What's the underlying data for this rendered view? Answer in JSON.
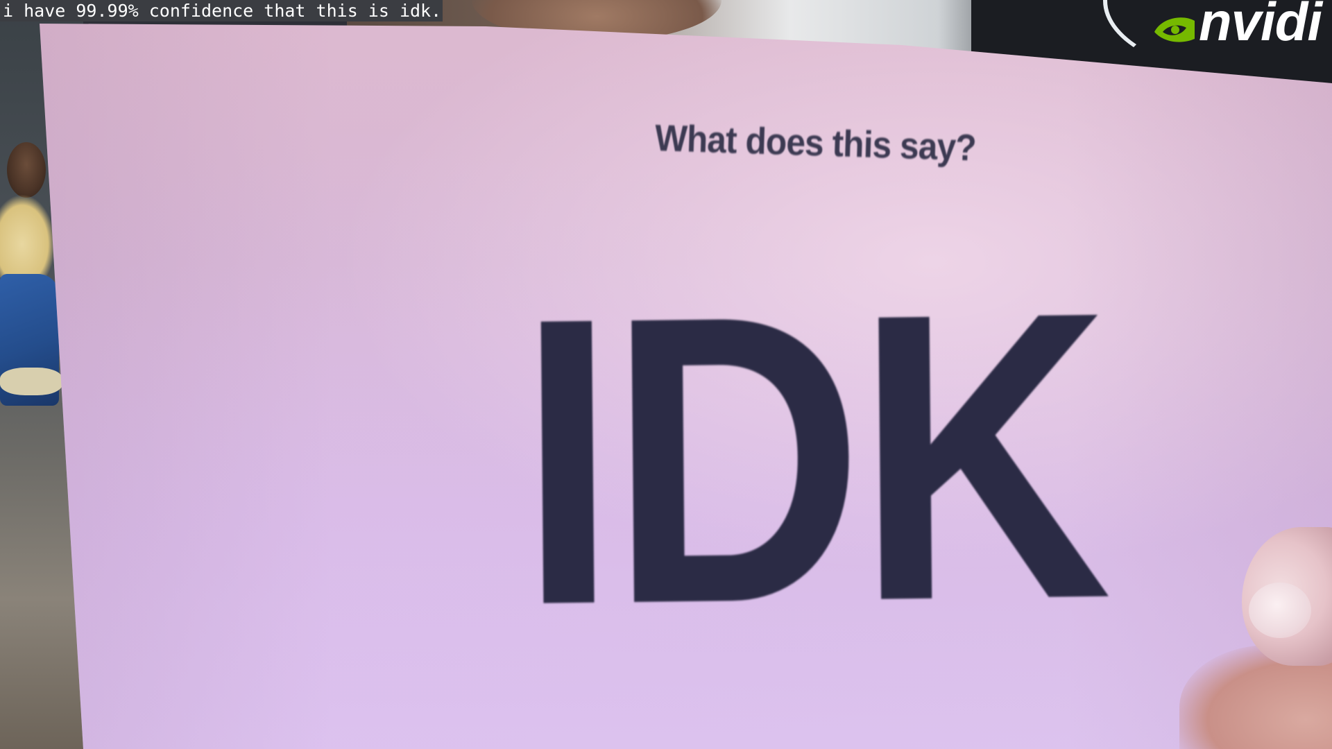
{
  "caption": {
    "text": "i have 99.99% confidence that this is idk."
  },
  "sign": {
    "question": "What does this say?",
    "word": "IDK"
  },
  "background": {
    "logo_icon": "nvidia-eye-icon",
    "logo_text": "nvidi"
  },
  "colors": {
    "paper": "#d9bce6",
    "ink": "#2b2b45",
    "caption_bg": "#3b3d42",
    "logo_green": "#76b900"
  }
}
